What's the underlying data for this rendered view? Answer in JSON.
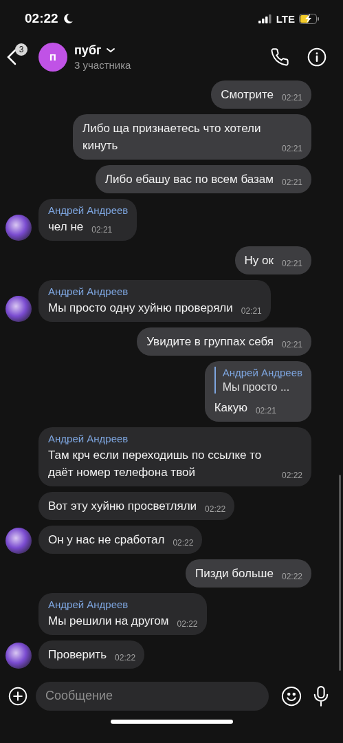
{
  "status_bar": {
    "time": "02:22",
    "network": "LTE"
  },
  "header": {
    "back_badge": "3",
    "avatar_letter": "п",
    "title": "пубг",
    "subtitle": "3 участника"
  },
  "messages": [
    {
      "kind": "out",
      "text": "Смотрите",
      "time": "02:21"
    },
    {
      "kind": "out",
      "text": "Либо ща признаетесь что хотели кинуть",
      "time": "02:21"
    },
    {
      "kind": "out",
      "text": "Либо ебашу вас по всем базам",
      "time": "02:21"
    },
    {
      "kind": "in",
      "author": "Андрей Андреев",
      "text": "чел не",
      "time": "02:21",
      "avatar": true
    },
    {
      "kind": "out",
      "text": "Ну ок",
      "time": "02:21"
    },
    {
      "kind": "in",
      "author": "Андрей Андреев",
      "text": "Мы просто одну хуйню проверяли",
      "time": "02:21",
      "avatar": true
    },
    {
      "kind": "out",
      "text": "Увидите в группах себя",
      "time": "02:21"
    },
    {
      "kind": "out",
      "reply": {
        "author": "Андрей Андреев",
        "text": "Мы просто ..."
      },
      "text": "Какую",
      "time": "02:21"
    },
    {
      "kind": "in",
      "author": "Андрей Андреев",
      "text": "Там крч если переходишь по ссылке то даёт номер телефона твой",
      "time": "02:22",
      "avatar": false
    },
    {
      "kind": "in",
      "text": "Вот эту хуйню просветляли",
      "time": "02:22",
      "avatar": false
    },
    {
      "kind": "in",
      "text": "Он у нас не сработал",
      "time": "02:22",
      "avatar": true
    },
    {
      "kind": "out",
      "text": "Пизди больше",
      "time": "02:22"
    },
    {
      "kind": "in",
      "author": "Андрей Андреев",
      "text": "Мы решили на другом",
      "time": "02:22",
      "avatar": false
    },
    {
      "kind": "in",
      "text": "Проверить",
      "time": "02:22",
      "avatar": true
    }
  ],
  "composer": {
    "placeholder": "Сообщение"
  }
}
